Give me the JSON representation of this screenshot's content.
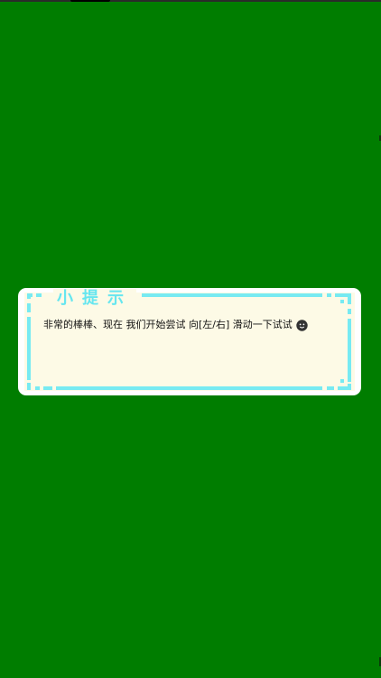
{
  "dialog": {
    "title": "小提示",
    "message": "非常的棒棒、现在 我们开始尝试 向[左/右] 滑动一下试试",
    "message_icon": "smiling-emoji-icon"
  },
  "colors": {
    "background": "#007d00",
    "dialog_fill": "#fdfae6",
    "frame_accent": "#77eaf2",
    "title_color": "#66e6ef"
  }
}
